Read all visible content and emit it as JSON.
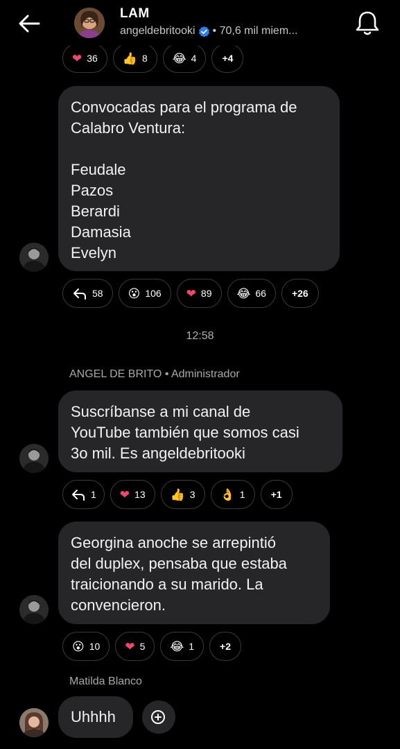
{
  "header": {
    "title": "LAM",
    "handle": "angeldebritooki",
    "member_count": "• 70,6 mil miem..."
  },
  "messages": [
    {
      "reactions": [
        {
          "icon": "heart",
          "emoji": "❤",
          "count": "36"
        },
        {
          "icon": "thumbs-up",
          "emoji": "👍",
          "count": "8"
        },
        {
          "icon": "laughing",
          "emoji": "😂",
          "count": "4"
        },
        {
          "icon": "more",
          "count": "+4"
        }
      ]
    },
    {
      "lines": [
        "Convocadas para el programa de",
        "Calabro Ventura:",
        "",
        "Feudale",
        "Pazos",
        "Berardi",
        "Damasia",
        "Evelyn"
      ],
      "reactions": [
        {
          "icon": "reply",
          "count": "58"
        },
        {
          "icon": "surprised",
          "emoji": "😮",
          "count": "106"
        },
        {
          "icon": "heart",
          "emoji": "❤",
          "count": "89"
        },
        {
          "icon": "laughing",
          "emoji": "😂",
          "count": "66"
        },
        {
          "icon": "more",
          "count": "+26"
        }
      ]
    },
    {
      "timestamp": "12:58",
      "sender": "ANGEL DE BRITO • Administrador",
      "lines": [
        "Suscríbanse a mi canal de",
        "YouTube también que somos casi",
        "3o mil. Es angeldebritooki"
      ],
      "reactions": [
        {
          "icon": "reply",
          "count": "1"
        },
        {
          "icon": "heart",
          "emoji": "❤",
          "count": "13"
        },
        {
          "icon": "thumbs-up",
          "emoji": "👍",
          "count": "3"
        },
        {
          "icon": "ok-hand",
          "emoji": "👌",
          "count": "1"
        },
        {
          "icon": "more",
          "count": "+1"
        }
      ]
    },
    {
      "lines": [
        "Georgina anoche se arrepintió",
        "del duplex, pensaba que estaba",
        "traicionando a su marido. La",
        "convencieron."
      ],
      "reactions": [
        {
          "icon": "surprised",
          "emoji": "😮",
          "count": "10"
        },
        {
          "icon": "heart",
          "emoji": "❤",
          "count": "5"
        },
        {
          "icon": "laughing",
          "emoji": "😂",
          "count": "1"
        },
        {
          "icon": "more",
          "count": "+2"
        }
      ]
    },
    {
      "sender": "Matilda Blanco",
      "lines": [
        "Uhhhh"
      ]
    }
  ],
  "colors": {
    "background": "#000000",
    "bubble": "#262628",
    "pill_border": "#3a3a3c",
    "verified": "#2f80ed",
    "heart": "#f0476f"
  }
}
